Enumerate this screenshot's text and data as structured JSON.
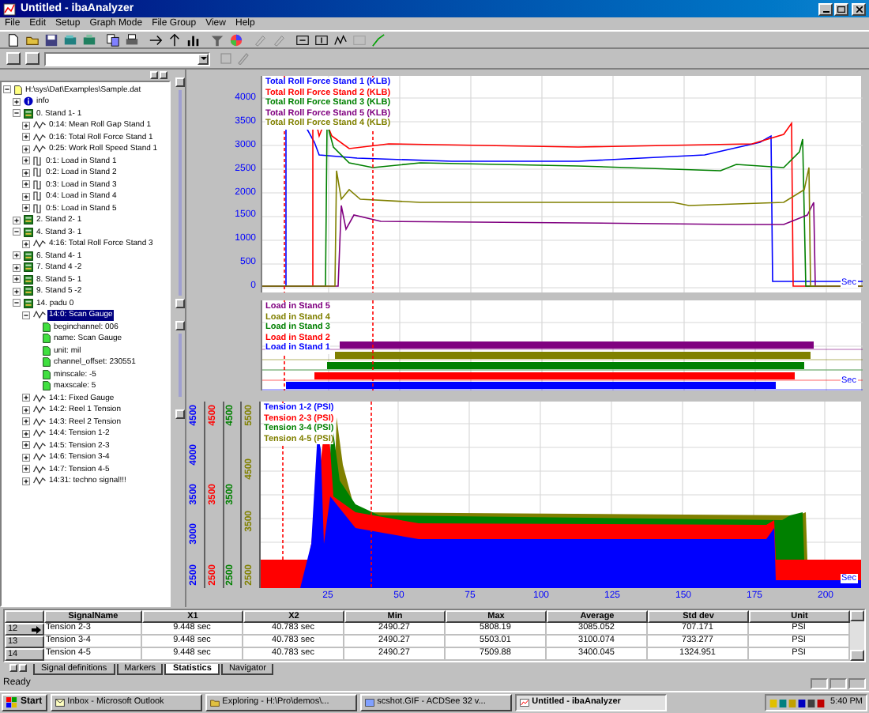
{
  "window": {
    "title": "Untitled - ibaAnalyzer"
  },
  "menu": [
    "File",
    "Edit",
    "Setup",
    "Graph Mode",
    "File Group",
    "View",
    "Help"
  ],
  "tree": {
    "label": "H:\\sys\\Dat\\Examples\\Sample.dat",
    "kind": "file",
    "expanded": true,
    "selected": false,
    "children": [
      {
        "label": "info",
        "kind": "info",
        "expanded": false,
        "selected": false
      },
      {
        "label": "0. Stand 1- 1",
        "kind": "group",
        "expanded": true,
        "selected": false,
        "children": [
          {
            "label": "0:14: Mean Roll Gap Stand 1",
            "kind": "analog",
            "expanded": false,
            "selected": false
          },
          {
            "label": "0:16: Total Roll Force Stand 1",
            "kind": "analog",
            "expanded": false,
            "selected": false
          },
          {
            "label": "0:25: Work Roll Speed Stand 1",
            "kind": "analog",
            "expanded": false,
            "selected": false
          },
          {
            "label": "0:1: Load in Stand 1",
            "kind": "digital",
            "expanded": false,
            "selected": false
          },
          {
            "label": "0:2: Load in Stand 2",
            "kind": "digital",
            "expanded": false,
            "selected": false
          },
          {
            "label": "0:3: Load in Stand 3",
            "kind": "digital",
            "expanded": false,
            "selected": false
          },
          {
            "label": "0:4: Load in Stand 4",
            "kind": "digital",
            "expanded": false,
            "selected": false
          },
          {
            "label": "0:5: Load in Stand 5",
            "kind": "digital",
            "expanded": false,
            "selected": false
          }
        ]
      },
      {
        "label": "2. Stand 2- 1",
        "kind": "group",
        "expanded": false,
        "selected": false
      },
      {
        "label": "4. Stand 3- 1",
        "kind": "group",
        "expanded": true,
        "selected": false,
        "children": [
          {
            "label": "4:16: Total Roll Force Stand 3",
            "kind": "analog",
            "expanded": false,
            "selected": false
          }
        ]
      },
      {
        "label": "6. Stand 4- 1",
        "kind": "group",
        "expanded": false,
        "selected": false
      },
      {
        "label": "7. Stand 4 -2",
        "kind": "group",
        "expanded": false,
        "selected": false
      },
      {
        "label": "8. Stand 5- 1",
        "kind": "group",
        "expanded": false,
        "selected": false
      },
      {
        "label": "9. Stand 5 -2",
        "kind": "group",
        "expanded": false,
        "selected": false
      },
      {
        "label": "14. padu 0",
        "kind": "group",
        "expanded": true,
        "selected": false,
        "children": [
          {
            "label": "14:0: Scan Gauge",
            "kind": "analog",
            "expanded": true,
            "selected": true,
            "children": [
              {
                "label": "beginchannel: 006",
                "kind": "property",
                "selected": false
              },
              {
                "label": "name: Scan Gauge",
                "kind": "property",
                "selected": false
              },
              {
                "label": "unit: mil",
                "kind": "property",
                "selected": false
              },
              {
                "label": "channel_offset: 230551",
                "kind": "property",
                "selected": false
              },
              {
                "label": "minscale: -5",
                "kind": "property",
                "selected": false
              },
              {
                "label": "maxscale: 5",
                "kind": "property",
                "selected": false
              }
            ]
          },
          {
            "label": "14:1: Fixed Gauge",
            "kind": "analog",
            "expanded": false,
            "selected": false
          },
          {
            "label": "14:2: Reel 1 Tension",
            "kind": "analog",
            "expanded": false,
            "selected": false
          },
          {
            "label": "14:3: Reel 2 Tension",
            "kind": "analog",
            "expanded": false,
            "selected": false
          },
          {
            "label": "14:4: Tension 1-2",
            "kind": "analog",
            "expanded": false,
            "selected": false
          },
          {
            "label": "14:5: Tension 2-3",
            "kind": "analog",
            "expanded": false,
            "selected": false
          },
          {
            "label": "14:6: Tension 3-4",
            "kind": "analog",
            "expanded": false,
            "selected": false
          },
          {
            "label": "14:7: Tension 4-5",
            "kind": "analog",
            "expanded": false,
            "selected": false
          },
          {
            "label": "14:31: techno signal!!!",
            "kind": "analog",
            "expanded": false,
            "selected": false
          }
        ]
      }
    ]
  },
  "force_plot": {
    "x_unit": "Sec",
    "axes": [
      {
        "color": "#0000ff",
        "ticks": [
          "4000",
          "3500",
          "3000",
          "2500",
          "2000",
          "1500",
          "1000",
          "500",
          "0"
        ]
      }
    ],
    "legend": [
      {
        "label": "Total Roll Force Stand 1 (KLB)",
        "color": "#0000ff"
      },
      {
        "label": "Total Roll Force Stand 2 (KLB)",
        "color": "#ff0000"
      },
      {
        "label": "Total Roll Force Stand 3 (KLB)",
        "color": "#008000"
      },
      {
        "label": "Total Roll Force Stand 5 (KLB)",
        "color": "#800080"
      },
      {
        "label": "Total Roll Force Stand 4 (KLB)",
        "color": "#808000"
      }
    ]
  },
  "load_plot": {
    "x_unit": "Sec",
    "legend": [
      {
        "label": "Load in Stand 5",
        "color": "#800080"
      },
      {
        "label": "Load in Stand 4",
        "color": "#808000"
      },
      {
        "label": "Load in Stand 3",
        "color": "#008000"
      },
      {
        "label": "Load in Stand 2",
        "color": "#ff0000"
      },
      {
        "label": "Load in Stand 1",
        "color": "#0000ff"
      }
    ]
  },
  "tension_plot": {
    "x_unit": "Sec",
    "x_ticks": [
      "25",
      "50",
      "75",
      "100",
      "125",
      "150",
      "175",
      "200"
    ],
    "axes": [
      {
        "color": "#0000ff",
        "ticks": [
          "4500",
          "4000",
          "3500",
          "3000",
          "2500"
        ]
      },
      {
        "color": "#ff0000",
        "ticks": [
          "4500",
          "3500",
          "2500"
        ]
      },
      {
        "color": "#008000",
        "ticks": [
          "4500",
          "3500",
          "2500"
        ]
      },
      {
        "color": "#808000",
        "ticks": [
          "5500",
          "4500",
          "3500",
          "2500"
        ]
      }
    ],
    "legend": [
      {
        "label": "Tension 1-2 (PSI)",
        "color": "#0000ff"
      },
      {
        "label": "Tension 2-3 (PSI)",
        "color": "#ff0000"
      },
      {
        "label": "Tension 3-4 (PSI)",
        "color": "#008000"
      },
      {
        "label": "Tension 4-5 (PSI)",
        "color": "#808000"
      }
    ]
  },
  "table": {
    "columns": [
      "SignalName",
      "X1",
      "X2",
      "Min",
      "Max",
      "Average",
      "Std dev",
      "Unit"
    ],
    "rows": [
      {
        "number": "12",
        "current": true,
        "cells": [
          "Tension 2-3",
          "9.448 sec",
          "40.783 sec",
          "2490.27",
          "5808.19",
          "3085.052",
          "707.171",
          "PSI"
        ]
      },
      {
        "number": "13",
        "current": false,
        "cells": [
          "Tension 3-4",
          "9.448 sec",
          "40.783 sec",
          "2490.27",
          "5503.01",
          "3100.074",
          "733.277",
          "PSI"
        ]
      },
      {
        "number": "14",
        "current": false,
        "cells": [
          "Tension 4-5",
          "9.448 sec",
          "40.783 sec",
          "2490.27",
          "7509.88",
          "3400.045",
          "1324.951",
          "PSI"
        ]
      }
    ]
  },
  "tabs": [
    {
      "label": "Signal definitions",
      "selected": false
    },
    {
      "label": "Markers",
      "selected": false
    },
    {
      "label": "Statistics",
      "selected": true
    },
    {
      "label": "Navigator",
      "selected": false
    }
  ],
  "status_bar": {
    "text": "Ready"
  },
  "taskbar": {
    "start": "Start",
    "clock": "5:40 PM",
    "tasks": [
      {
        "label": "Inbox - Microsoft Outlook",
        "kind": "mail",
        "selected": false
      },
      {
        "label": "Exploring - H:\\Pro\\demos\\...",
        "kind": "explorer",
        "selected": false
      },
      {
        "label": "scshot.GIF - ACDSee 32 v...",
        "kind": "viewer",
        "selected": false
      },
      {
        "label": "Untitled - ibaAnalyzer",
        "kind": "analyzer",
        "selected": true
      }
    ]
  }
}
